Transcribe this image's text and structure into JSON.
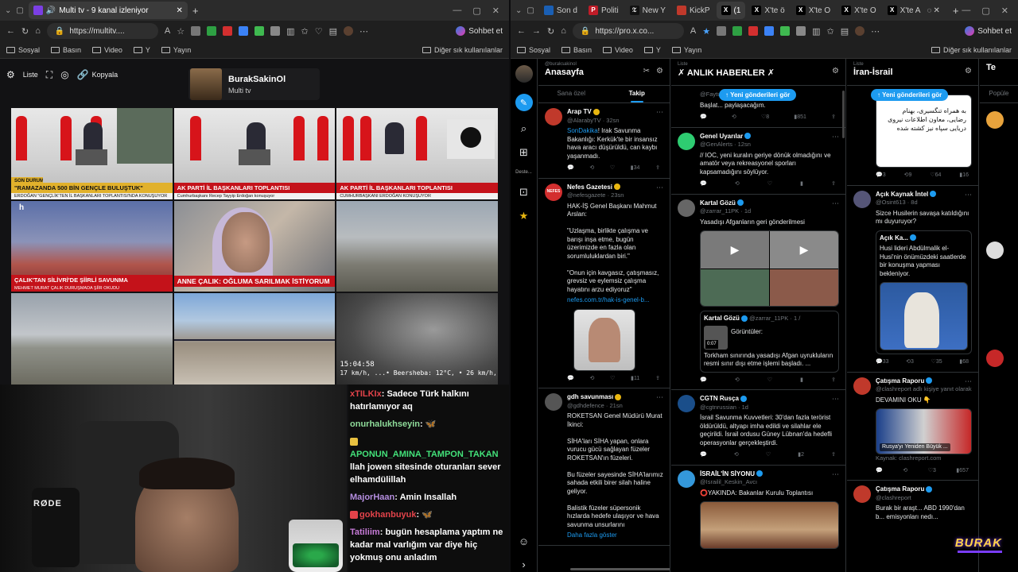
{
  "left_browser": {
    "tabs": [
      {
        "label": "Multi tv - 9 kanal izleniyor",
        "active": true
      }
    ],
    "address": "https://multitv....",
    "copilot_label": "Sohbet et",
    "bookmarks": [
      "Sosyal",
      "Basın",
      "Video",
      "Y",
      "Yayın"
    ],
    "bookmarks_right": "Diğer sık kullanılanlar"
  },
  "multitv": {
    "toolbar": {
      "list_label": "Liste",
      "copy_label": "Kopyala"
    },
    "channel": {
      "name": "BurakSakinOl",
      "sub": "Multi tv"
    },
    "tiles": [
      {
        "chyron": "\"RAMAZANDA 500 BİN GENÇLE BULUŞTUK\"",
        "sub": "ERDOĞAN \"GENÇLİK'TEN İL BAŞKANLARI TOPLANTISI'NDA KONUŞUYOR",
        "tag": "SON DURUM"
      },
      {
        "chyron": "AK PARTİ İL BAŞKANLARI TOPLANTISI",
        "sub": "Cumhurbaşkanı Recep Tayyip Erdoğan konuşuyor"
      },
      {
        "chyron": "AK PARTİ İL BAŞKANLARI TOPLANTISI",
        "sub": "CUMHURBAŞKANI ERDOĞAN KONUŞUYOR"
      },
      {
        "chyron": "ÇALIK'TAN SİLİVRİ'DE ŞİİRLİ SAVUNMA",
        "sub": "MEHMET MURAT ÇALIK DURUŞMADA ŞİİR OKUDU"
      },
      {
        "chyron": "ANNE ÇALIK: OĞLUMA SARILMAK İSTİYORUM"
      },
      {},
      {},
      {},
      {
        "time": "15:04:58",
        "overlay": "17 km/h, ...• Beersheba: 12°C, • 26 km/h, ... Tel Av"
      }
    ]
  },
  "webcam": {
    "mic_label": "RØDE"
  },
  "chat": [
    {
      "user": "xTILKIx",
      "text": "Sadece Türk halkını hatırlamıyor aq"
    },
    {
      "user": "onurhalukhseyin",
      "text": ""
    },
    {
      "user": "APONUN_AMINA_TAMPON_TAKAN",
      "text": "llah jowen sitesinde oturanları sever elhamdülillah"
    },
    {
      "user": "MajorHaan",
      "text": "Amin Insallah"
    },
    {
      "user": "gokhanbuyuk",
      "text": ""
    },
    {
      "user": "Tatiliim",
      "text": "bugün hesaplama yaptım ne kadar mal varlığım var diye hiç yokmuş onu anladım"
    }
  ],
  "right_browser": {
    "tabs": [
      "Son d",
      "Politi",
      "New Y",
      "KickP",
      "(1",
      "X'te ö",
      "X'te O",
      "X'te O",
      "X'te A"
    ],
    "address": "https://pro.x.co...",
    "copilot_label": "Sohbet et",
    "bookmarks": [
      "Sosyal",
      "Basın",
      "Video",
      "Y",
      "Yayın"
    ],
    "bookmarks_right": "Diğer sık kullanılanlar"
  },
  "xpro": {
    "rail_label": "Deste...",
    "columns": [
      {
        "tiny": "@buraksakinol",
        "title": "Anasayfa",
        "subtabs": [
          "Sana özel",
          "Takip"
        ],
        "tweets": [
          {
            "name": "Arap TV",
            "handle": "@AlarabyTV · 32sn",
            "avatar_color": "#c0392b",
            "text_link": "SonDakika",
            "text": "! Irak Savunma Bakanlığı: Kerkük'te bir insansız hava aracı düşürüldü, can kaybı yaşanmadı.",
            "stats": [
              "",
              "",
              "",
              "34"
            ]
          },
          {
            "name": "Nefes Gazetesi",
            "handle": "@nefesgazete · 23sn",
            "avatar_color": "#d32f2f",
            "avatar_text": "NEFES",
            "text": "HAK-İŞ Genel Başkanı Mahmut Arslan:\n\n\"Uzlaşma, birlikte çalışma ve barışı inşa etme, bugün üzerimizde en fazla olan sorumluluklardan biri.\"\n\n\"Onun için kavgasız, çatışmasız, grevsiz ve eylemsiz çalışma hayatını arzu ediyoruz\"",
            "link": "nefes.com.tr/hak-is-genel-b...",
            "stats": [
              "",
              "",
              "",
              "11"
            ]
          },
          {
            "name": "gdh savunması",
            "handle": "@gdhdefence · 21sn",
            "avatar_color": "#555",
            "text": "ROKETSAN Genel Müdürü Murat İkinci:\n\nSİHA'ları SİHA yapan, onlara vurucu gücü sağlayan füzeler ROKETSAN'ın füzeleri.\n\nBu füzeler sayesinde SİHA'larımız sahada etkili birer silah haline geliyor.\n\nBalistik füzeler süpersonik hızlarda hedefe ulaşıyor ve hava savunma unsurlarını",
            "more": "Daha fazla göster"
          }
        ]
      },
      {
        "tiny": "Liste",
        "title": "✗ ANLIK HABERLER ✗",
        "new_posts": "Yeni gönderileri gör",
        "tweets": [
          {
            "name": "",
            "handle": "@Fayturks adlı kişiye yanıt olarak",
            "avatar_color": "#000",
            "text": "Başlat... paylaşacağım.",
            "stats": [
              "",
              "",
              "8",
              "851"
            ]
          },
          {
            "name": "Genel Uyarılar",
            "handle": "@GenAlerts · 12sn",
            "avatar_color": "#2ecc71",
            "text": "// IOC, yeni kuralın geriye dönük olmadığını ve amatör veya rekreasyonel sporları kapsamadığını söylüyor.",
            "stats": [
              "",
              "",
              "",
              ""
            ]
          },
          {
            "name": "Kartal Gözü",
            "handle": "@zarrar_11PK · 1d",
            "avatar_color": "#666",
            "text": "Yasadışı Afganların geri gönderilmesi",
            "quote_name": "Kartal Gözü",
            "quote_handle": "@zarrar_11PK · 1 /",
            "quote_head": "Görüntüler:",
            "video_time": "0:07",
            "quote_text": "Torkham sınırında yasadışı Afgan uyrukluların resmi sınır dışı etme işlemi başladı. ...",
            "stats": [
              "",
              "",
              "",
              ""
            ]
          },
          {
            "name": "CGTN Rusça",
            "handle": "@cgtnrussian · 1d",
            "avatar_color": "#1a4e8a",
            "text": "İsrail Savunma Kuvvetleri: 30'dan fazla terörist öldürüldü, altyapı imha edildi ve silahlar ele geçirildi. İsrail ordusu Güney Lübnan'da hedefli operasyonlar gerçekleştirdi.",
            "stats": [
              "",
              "",
              "",
              "2"
            ]
          },
          {
            "name": "İSRAİL'İN SİYONU",
            "handle": "@Israilil_Keskin_Avcı",
            "avatar_color": "#3498db",
            "text": "YAKINDA: Bakanlar Kurulu Toplantısı"
          }
        ]
      },
      {
        "tiny": "Liste",
        "title": "İran-İsrail",
        "new_posts": "Yeni gönderileri gör",
        "tweets": [
          {
            "name": "",
            "handle": "",
            "avatar_color": "#000",
            "text": "به همراه تنگسیری، بهنام رضایی، معاون اطلاعات نیروی دریایی سپاه نیز کشته شده",
            "stats": [
              "3",
              "9",
              "64",
              "16"
            ]
          },
          {
            "name": "Açık Kaynak İntel",
            "handle": "@Osint613 · 8d",
            "avatar_color": "#557",
            "text": "Sizce Husilerin savaşa katıldığını mı duyuruyor?",
            "quote_name": "Açık Ka...",
            "quote_text": "Husi lideri Abdülmalik el-Husi'nin önümüzdeki saatlerde bir konuşma yapması bekleniyor.",
            "stats": [
              "33",
              "3",
              "35",
              "68"
            ]
          },
          {
            "name": "Çatışma Raporu",
            "handle": "@clashreport adlı kişiye yanıt olarak",
            "avatar_color": "#c0392b",
            "text": "DEVAMINI OKU 👇",
            "card_title": "Rusya'yı Yeniden Büyük ...",
            "card_domain": "Kaynak: clashreport.com",
            "stats": [
              "",
              "",
              "3",
              "657"
            ]
          },
          {
            "name": "Çatışma Raporu",
            "handle": "@clashreport",
            "avatar_color": "#c0392b",
            "text": "Burak bir araşt... ABD 1990'dan b... emisyonları nedı..."
          }
        ]
      },
      {
        "tiny": "",
        "title": "Te",
        "subtabs": [
          "Popüle"
        ]
      }
    ]
  },
  "overlay_logo": "BURAK",
  "colors": {
    "accent": "#1d9bf0",
    "ak_red": "#d7141a",
    "twitch_purple": "#7a3cff"
  }
}
